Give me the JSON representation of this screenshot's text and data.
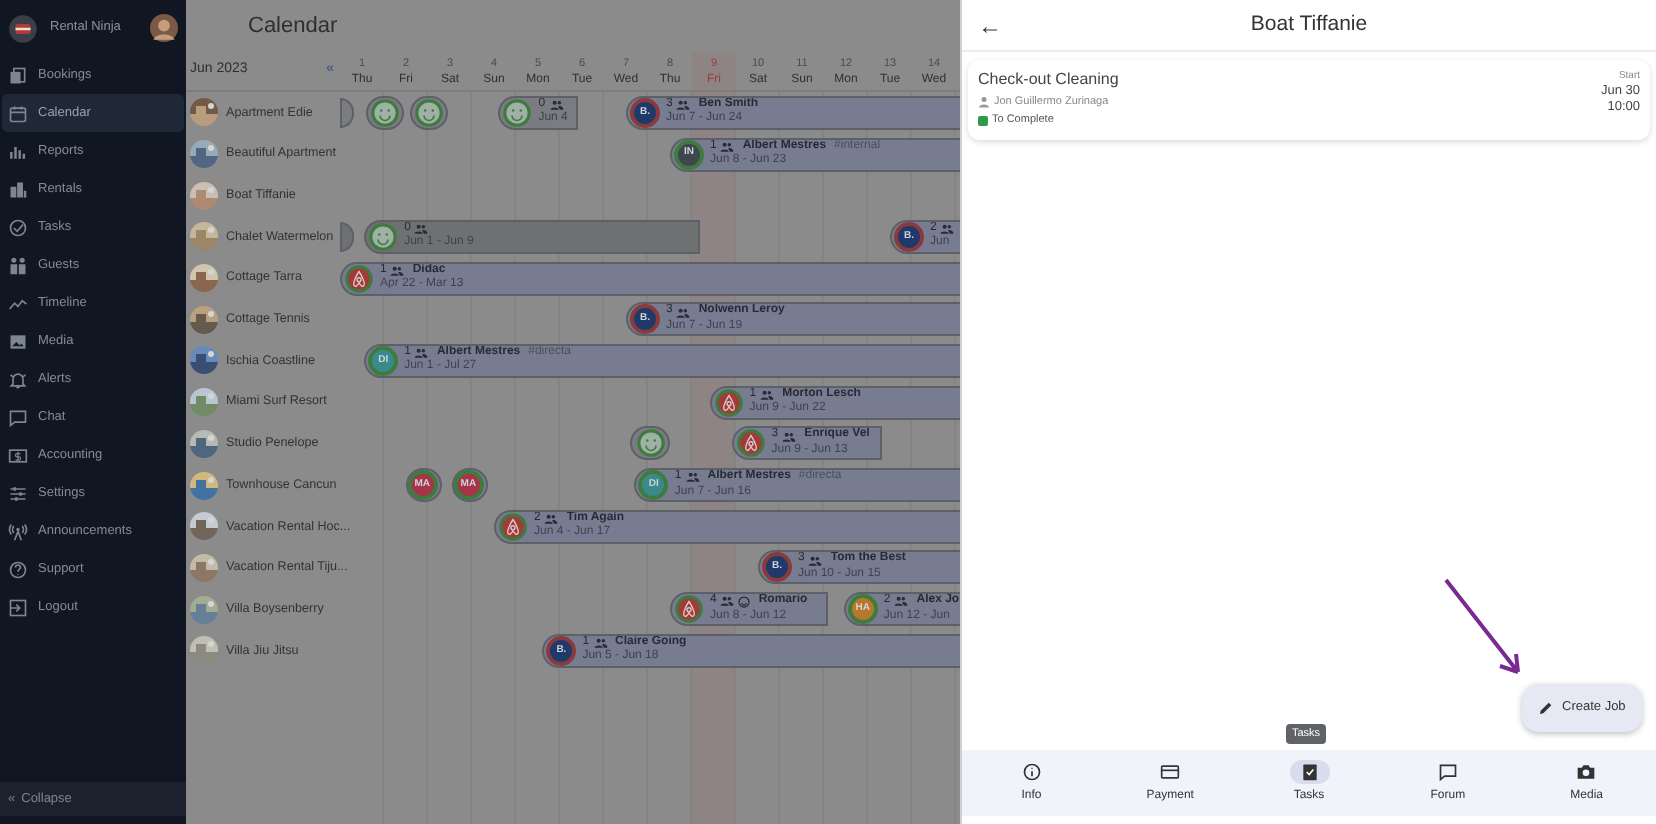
{
  "sidebar": {
    "brand": "Rental Ninja",
    "items": [
      {
        "label": "Bookings",
        "selected": false
      },
      {
        "label": "Calendar",
        "selected": true
      },
      {
        "label": "Reports",
        "selected": false
      },
      {
        "label": "Rentals",
        "selected": false
      },
      {
        "label": "Tasks",
        "selected": false
      },
      {
        "label": "Guests",
        "selected": false
      },
      {
        "label": "Timeline",
        "selected": false
      },
      {
        "label": "Media",
        "selected": false
      },
      {
        "label": "Alerts",
        "selected": false
      },
      {
        "label": "Chat",
        "selected": false
      },
      {
        "label": "Accounting",
        "selected": false
      },
      {
        "label": "Settings",
        "selected": false
      },
      {
        "label": "Announcements",
        "selected": false
      },
      {
        "label": "Support",
        "selected": false
      },
      {
        "label": "Logout",
        "selected": false
      }
    ],
    "collapse": {
      "icon": "«",
      "label": "Collapse"
    }
  },
  "calendar": {
    "title": "Calendar",
    "month": "Jun 2023",
    "prev": "«",
    "days": [
      {
        "date": "1",
        "weekday": "Thu",
        "today": false
      },
      {
        "date": "2",
        "weekday": "Fri",
        "today": false
      },
      {
        "date": "3",
        "weekday": "Sat",
        "today": false
      },
      {
        "date": "4",
        "weekday": "Sun",
        "today": false
      },
      {
        "date": "5",
        "weekday": "Mon",
        "today": false
      },
      {
        "date": "6",
        "weekday": "Tue",
        "today": false
      },
      {
        "date": "7",
        "weekday": "Wed",
        "today": false
      },
      {
        "date": "8",
        "weekday": "Thu",
        "today": false
      },
      {
        "date": "9",
        "weekday": "Fri",
        "today": true
      },
      {
        "date": "10",
        "weekday": "Sat",
        "today": false
      },
      {
        "date": "11",
        "weekday": "Sun",
        "today": false
      },
      {
        "date": "12",
        "weekday": "Mon",
        "today": false
      },
      {
        "date": "13",
        "weekday": "Tue",
        "today": false
      },
      {
        "date": "14",
        "weekday": "Wed",
        "today": false
      }
    ],
    "rentals": [
      {
        "name": "Apartment Edie",
        "bookings": [
          {
            "kind": "edge",
            "color": "#7a7c82"
          },
          {
            "kind": "chip",
            "color": "#7a7c82",
            "avatar": {
              "kind": "smiley"
            }
          },
          {
            "kind": "chip",
            "color": "#7a7c82",
            "avatar": {
              "kind": "smiley"
            }
          },
          {
            "kind": "booking",
            "color": "#7a7c82",
            "avatar": {
              "kind": "smiley"
            },
            "guests": "0",
            "dates": "Jun 4",
            "smiley": false
          },
          {
            "kind": "booking",
            "color": "#777c90",
            "avatar": {
              "kind": "logo",
              "text": "B."
            },
            "guests": "3",
            "name": "Ben Smith",
            "dates": "Jun 7 - Jun 24",
            "smiley": false
          }
        ]
      },
      {
        "name": "Beautiful Apartment",
        "bookings": [
          {
            "kind": "booking",
            "color": "#777c90",
            "avatar": {
              "kind": "initials",
              "text": "IN",
              "color": "#3f4650"
            },
            "guests": "1",
            "name": "Albert Mestres",
            "tag": "#internal",
            "dates": "Jun 8 - Jun 23",
            "smiley": false
          }
        ]
      },
      {
        "name": "Boat Tiffanie"
      },
      {
        "name": "Chalet Watermelon",
        "bookings": [
          {
            "kind": "edge",
            "color": "#6f7072"
          },
          {
            "kind": "booking",
            "color": "#6f7072",
            "avatar": {
              "kind": "smiley"
            },
            "guests": "0",
            "dates": "Jun 1 - Jun 9",
            "smiley": false
          },
          {
            "kind": "booking",
            "color": "#777c90",
            "avatar": {
              "kind": "logo",
              "text": "B."
            },
            "guests": "2",
            "dates": "Jun",
            "smiley": false
          }
        ]
      },
      {
        "name": "Cottage Tarra",
        "bookings": [
          {
            "kind": "booking",
            "color": "#777c90",
            "avatar": {
              "kind": "airbnb"
            },
            "guests": "1",
            "name": "Didac",
            "dates": "Apr 22 - Mar 13",
            "smiley": false
          }
        ]
      },
      {
        "name": "Cottage Tennis",
        "bookings": [
          {
            "kind": "booking",
            "color": "#777c90",
            "avatar": {
              "kind": "logo",
              "text": "B."
            },
            "guests": "3",
            "name": "Nolwenn Leroy",
            "dates": "Jun 7 - Jun 19",
            "smiley": false
          }
        ]
      },
      {
        "name": "Ischia Coastline",
        "bookings": [
          {
            "kind": "booking",
            "color": "#777c90",
            "avatar": {
              "kind": "initials",
              "text": "DI",
              "color": "#3a8a8c"
            },
            "guests": "1",
            "name": "Albert Mestres",
            "tag": "#directa",
            "dates": "Jun 1 - Jul 27",
            "smiley": false
          }
        ]
      },
      {
        "name": "Miami Surf Resort",
        "bookings": [
          {
            "kind": "booking",
            "color": "#777c90",
            "avatar": {
              "kind": "airbnb"
            },
            "guests": "1",
            "name": "Morton Lesch",
            "dates": "Jun 9 - Jun 22",
            "smiley": false
          }
        ]
      },
      {
        "name": "Studio Penelope",
        "bookings": [
          {
            "kind": "chip",
            "color": "#7a7c82",
            "avatar": {
              "kind": "smiley"
            }
          },
          {
            "kind": "booking",
            "color": "#777c90",
            "avatar": {
              "kind": "airbnb"
            },
            "guests": "3",
            "name": "Enrique Vel",
            "dates": "Jun 9 - Jun 13",
            "smiley": false
          }
        ]
      },
      {
        "name": "Townhouse Cancun",
        "bookings": [
          {
            "kind": "chip",
            "color": "#777c90",
            "avatar": {
              "kind": "initials",
              "text": "MA",
              "color": "#a8344a"
            }
          },
          {
            "kind": "chip",
            "color": "#777c90",
            "avatar": {
              "kind": "initials",
              "text": "MA",
              "color": "#a8344a"
            }
          },
          {
            "kind": "booking",
            "color": "#777c90",
            "avatar": {
              "kind": "initials",
              "text": "DI",
              "color": "#3a8a8c"
            },
            "guests": "1",
            "name": "Albert Mestres",
            "tag": "#directa",
            "dates": "Jun 7 - Jun 16",
            "smiley": false
          }
        ]
      },
      {
        "name": "Vacation Rental Hoc...",
        "bookings": [
          {
            "kind": "booking",
            "color": "#777c90",
            "avatar": {
              "kind": "airbnb"
            },
            "guests": "2",
            "name": "Tim Again",
            "dates": "Jun 4 - Jun 17",
            "smiley": false
          }
        ]
      },
      {
        "name": "Vacation Rental Tiju...",
        "bookings": [
          {
            "kind": "booking",
            "color": "#777c90",
            "avatar": {
              "kind": "logo",
              "text": "B."
            },
            "guests": "3",
            "name": "Tom the Best",
            "dates": "Jun 10 - Jun 15",
            "smiley": false
          }
        ]
      },
      {
        "name": "Villa Boysenberry",
        "bookings": [
          {
            "kind": "booking",
            "color": "#777c90",
            "avatar": {
              "kind": "airbnb"
            },
            "guests": "4",
            "name": "Romario",
            "dates": "Jun 8 - Jun 12",
            "smiley": true
          },
          {
            "kind": "booking",
            "color": "#777c90",
            "avatar": {
              "kind": "initials",
              "text": "HA",
              "color": "#b8782c"
            },
            "guests": "2",
            "name": "Alex Jo",
            "dates": "Jun 12 - Jun",
            "smiley": false
          }
        ]
      },
      {
        "name": "Villa Jiu Jitsu",
        "bookings": [
          {
            "kind": "booking",
            "color": "#777c90",
            "avatar": {
              "kind": "logo",
              "text": "B."
            },
            "guests": "1",
            "name": "Claire Going",
            "dates": "Jun 5 - Jun 18",
            "smiley": false
          }
        ]
      }
    ]
  },
  "panel": {
    "back": "←",
    "title": "Boat Tiffanie",
    "task": {
      "title": "Check-out Cleaning",
      "assignee": "Jon Guillermo Zurinaga",
      "status": {
        "text": "To Complete",
        "color": "#2e9a4a"
      },
      "start_label": "Start",
      "start_date": "Jun 30",
      "start_time": "10:00"
    },
    "create_button": "Create Job",
    "tooltip": "Tasks",
    "nav": [
      {
        "label": "Info",
        "selected": false
      },
      {
        "label": "Payment",
        "selected": false
      },
      {
        "label": "Tasks",
        "selected": true
      },
      {
        "label": "Forum",
        "selected": false
      },
      {
        "label": "Media",
        "selected": false
      }
    ]
  }
}
